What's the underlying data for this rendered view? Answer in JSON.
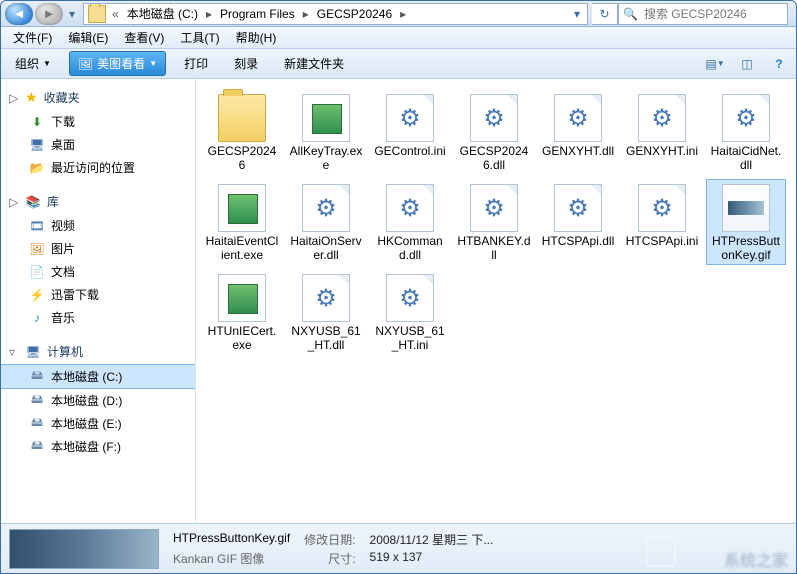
{
  "breadcrumbs": {
    "overflow": "«",
    "items": [
      "本地磁盘 (C:)",
      "Program Files",
      "GECSP20246"
    ],
    "sep": "▸"
  },
  "search": {
    "placeholder": "搜索 GECSP20246"
  },
  "menu": {
    "file": "文件(F)",
    "edit": "编辑(E)",
    "view": "查看(V)",
    "tools": "工具(T)",
    "help": "帮助(H)"
  },
  "toolbar": {
    "organize": "组织",
    "meitu": "美图看看",
    "print": "打印",
    "burn": "刻录",
    "newfolder": "新建文件夹"
  },
  "sidebar": {
    "fav_hdr": "收藏夹",
    "fav": [
      "下载",
      "桌面",
      "最近访问的位置"
    ],
    "lib_hdr": "库",
    "lib": [
      "视频",
      "图片",
      "文档",
      "迅雷下载",
      "音乐"
    ],
    "pc_hdr": "计算机",
    "drives": [
      "本地磁盘 (C:)",
      "本地磁盘 (D:)",
      "本地磁盘 (E:)",
      "本地磁盘 (F:)"
    ]
  },
  "files": [
    {
      "n": "GECSP20246",
      "t": "folder"
    },
    {
      "n": "AllKeyTray.exe",
      "t": "exe"
    },
    {
      "n": "GEControl.ini",
      "t": "ini"
    },
    {
      "n": "GECSP20246.dll",
      "t": "dll"
    },
    {
      "n": "GENXYHT.dll",
      "t": "dll"
    },
    {
      "n": "GENXYHT.ini",
      "t": "ini"
    },
    {
      "n": "HaitaiCidNet.dll",
      "t": "dll"
    },
    {
      "n": "HaitaiEventClient.exe",
      "t": "exe"
    },
    {
      "n": "HaitaiOnServer.dll",
      "t": "dll"
    },
    {
      "n": "HKCommand.dll",
      "t": "dll"
    },
    {
      "n": "HTBANKEY.dll",
      "t": "dll"
    },
    {
      "n": "HTCSPApi.dll",
      "t": "dll"
    },
    {
      "n": "HTCSPApi.ini",
      "t": "ini"
    },
    {
      "n": "HTPressButtonKey.gif",
      "t": "gif",
      "sel": true
    },
    {
      "n": "HTUnIECert.exe",
      "t": "exe"
    },
    {
      "n": "NXYUSB_61_HT.dll",
      "t": "dll"
    },
    {
      "n": "NXYUSB_61_HT.ini",
      "t": "ini"
    }
  ],
  "status": {
    "filename": "HTPressButtonKey.gif",
    "filetype": "Kankan GIF 图像",
    "date_lbl": "修改日期:",
    "date_val": "2008/11/12 星期三 下...",
    "size_lbl": "尺寸:",
    "size_val": "519 x 137"
  },
  "watermark": "系统之家"
}
